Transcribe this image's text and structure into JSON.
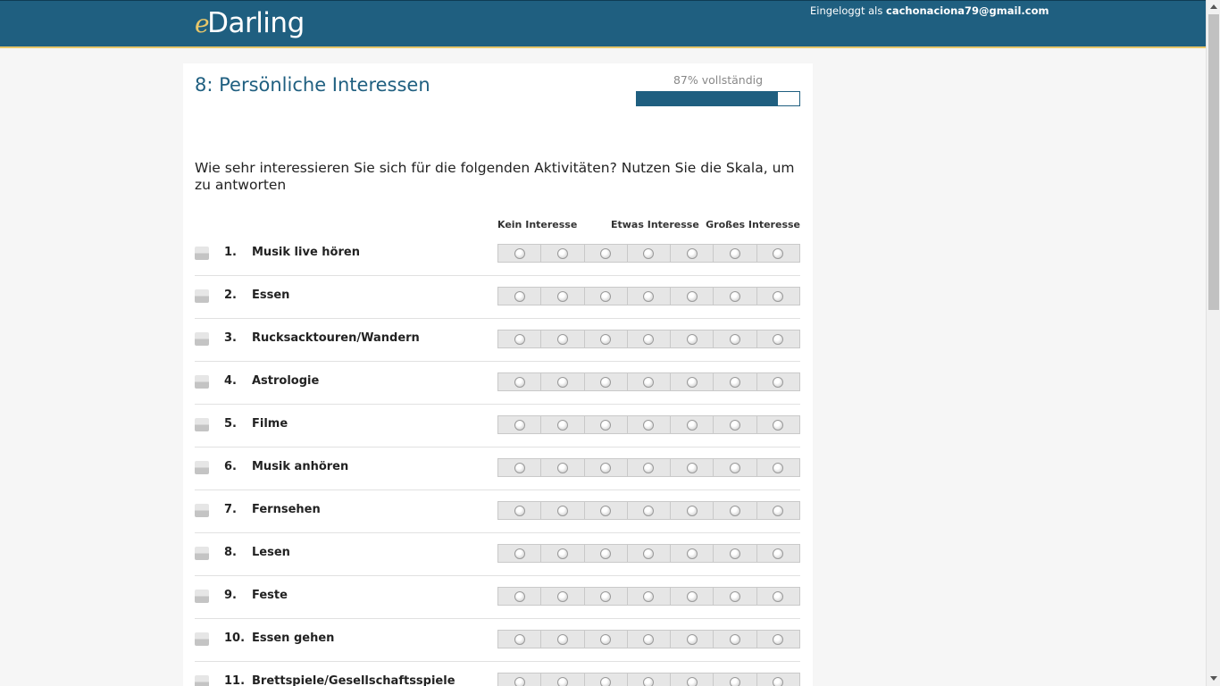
{
  "header": {
    "logo_e": "e",
    "logo_rest": "Darling",
    "login_prefix": "Eingeloggt als",
    "login_email": "cachonaciona79@gmail.com"
  },
  "section": {
    "title": "8: Persönliche Interessen",
    "progress_label": "87% vollständig",
    "progress_percent": 87
  },
  "question": "Wie sehr interessieren Sie sich für die folgenden Aktivitäten? Nutzen Sie die Skala, um zu antworten",
  "scale_labels": [
    "Kein Interesse",
    "Etwas Interesse",
    "Großes Interesse"
  ],
  "scale_points": 7,
  "items": [
    {
      "num": "1.",
      "label": "Musik live hören"
    },
    {
      "num": "2.",
      "label": "Essen"
    },
    {
      "num": "3.",
      "label": "Rucksacktouren/Wandern"
    },
    {
      "num": "4.",
      "label": "Astrologie"
    },
    {
      "num": "5.",
      "label": "Filme"
    },
    {
      "num": "6.",
      "label": "Musik anhören"
    },
    {
      "num": "7.",
      "label": "Fernsehen"
    },
    {
      "num": "8.",
      "label": "Lesen"
    },
    {
      "num": "9.",
      "label": "Feste"
    },
    {
      "num": "10.",
      "label": "Essen gehen"
    },
    {
      "num": "11.",
      "label": "Brettspiele/Gesellschaftsspiele"
    }
  ]
}
